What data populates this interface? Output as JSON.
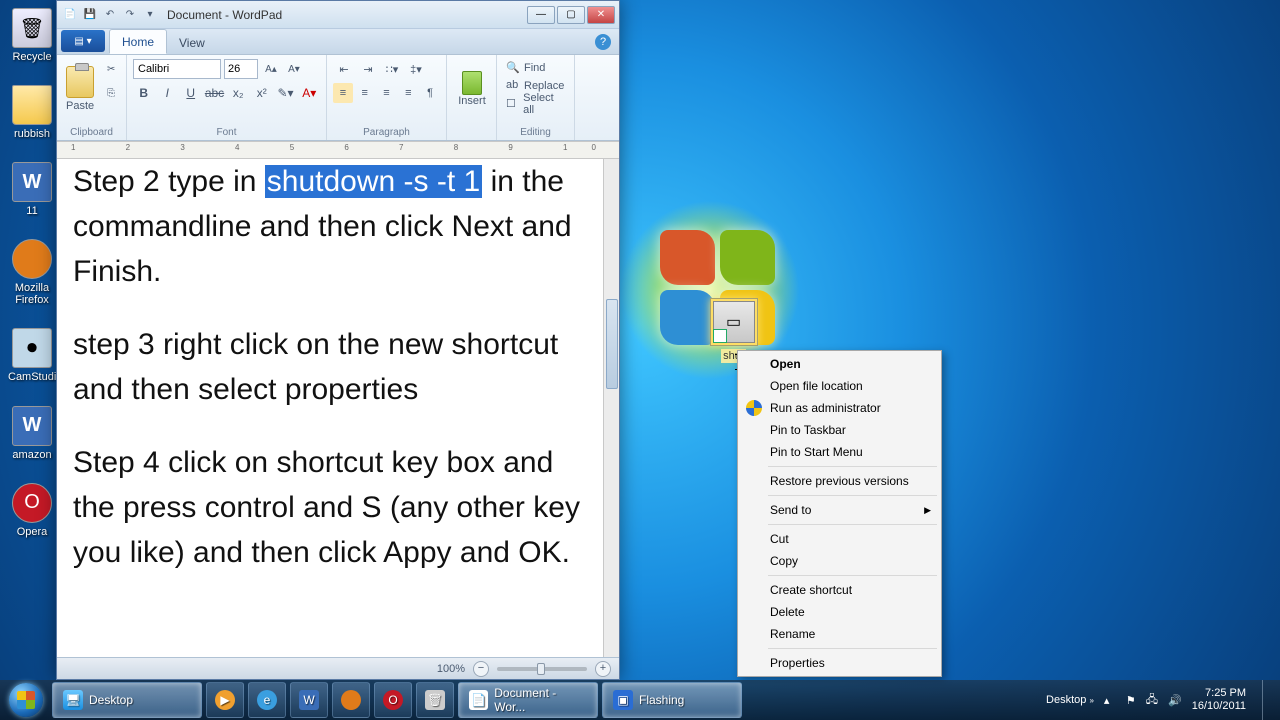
{
  "desktop_icons": {
    "recycle": "Recycle",
    "rubbish": "rubbish",
    "eleven": "11",
    "firefox": "Mozilla\nFirefox",
    "camstudio": "CamStudio",
    "amazon": "amazon",
    "opera": "Opera"
  },
  "shortcut": {
    "label": "shut"
  },
  "context_menu": {
    "open": "Open",
    "open_loc": "Open file location",
    "run_admin": "Run as administrator",
    "pin_taskbar": "Pin to Taskbar",
    "pin_start": "Pin to Start Menu",
    "restore": "Restore previous versions",
    "send_to": "Send to",
    "cut": "Cut",
    "copy": "Copy",
    "create_sc": "Create shortcut",
    "delete": "Delete",
    "rename": "Rename",
    "properties": "Properties"
  },
  "wordpad": {
    "title": "Document - WordPad",
    "tabs": {
      "home": "Home",
      "view": "View"
    },
    "ribbon": {
      "paste": "Paste",
      "clipboard": "Clipboard",
      "font_name": "Calibri",
      "font_size": "26",
      "font_group": "Font",
      "paragraph": "Paragraph",
      "insert": "Insert",
      "find": "Find",
      "replace": "Replace",
      "select_all": "Select all",
      "editing": "Editing"
    },
    "document": {
      "p1_a": "Step 2 type in ",
      "p1_hl": "shutdown -s -t 1",
      "p1_b": " in the commandline and then click Next and Finish.",
      "p2": "step 3 right click on the new shortcut and then select properties",
      "p3": "Step 4 click on shortcut key box and the press control and S (any other key you like) and then click Appy and OK."
    },
    "status": {
      "zoom": "100%"
    }
  },
  "taskbar": {
    "desktop": "Desktop",
    "doc": "Document - Wor...",
    "flashing": "Flashing",
    "tray_desktop": "Desktop",
    "time": "7:25 PM",
    "date": "16/10/2011"
  }
}
